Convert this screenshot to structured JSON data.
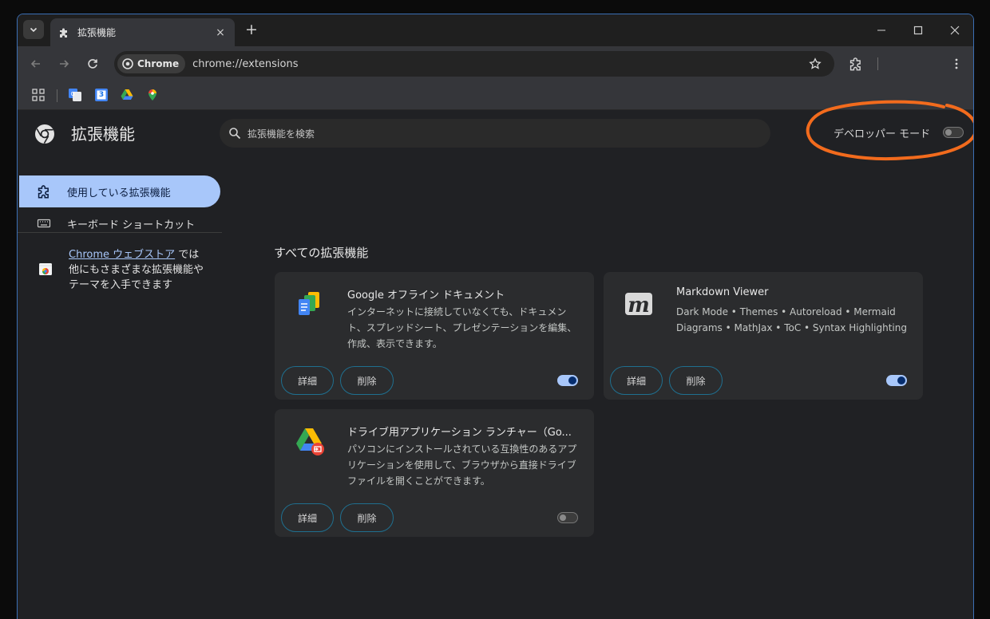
{
  "browser": {
    "tab": {
      "title": "拡張機能",
      "close_label": "×"
    },
    "new_tab_label": "+",
    "window_controls": {
      "minimize": "—",
      "maximize": "☐",
      "close": "✕"
    },
    "omnibox": {
      "chip_label": "Chrome",
      "url": "chrome://extensions"
    },
    "bookmarks": [
      "apps-grid-icon",
      "google-translate-icon",
      "google-calendar-icon",
      "google-drive-icon",
      "google-maps-icon"
    ],
    "calendar_day": "3"
  },
  "page": {
    "title": "拡張機能",
    "search_placeholder": "拡張機能を検索",
    "developer_mode": {
      "label": "デベロッパー モード",
      "enabled": false
    },
    "sidebar": {
      "items": [
        {
          "label": "使用している拡張機能",
          "active": true
        },
        {
          "label": "キーボード ショートカット",
          "active": false
        }
      ],
      "store": {
        "link": "Chrome ウェブストア",
        "text_after_link": " では",
        "text_rest": "他にもさまざまな拡張機能やテーマを入手できます"
      }
    },
    "section_title": "すべての拡張機能",
    "extensions": [
      {
        "name": "Google オフライン ドキュメント",
        "description": "インターネットに接続していなくても、ドキュメント、スプレッドシート、プレゼンテーションを編集、作成、表示できます。",
        "details_label": "詳細",
        "remove_label": "削除",
        "enabled": true
      },
      {
        "name": "Markdown Viewer",
        "description": "Dark Mode • Themes • Autoreload • Mermaid Diagrams • MathJax • ToC • Syntax Highlighting",
        "details_label": "詳細",
        "remove_label": "削除",
        "enabled": true
      },
      {
        "name": "ドライブ用アプリケーション ランチャー（Go...",
        "description": "パソコンにインストールされている互換性のあるアプリケーションを使用して、ブラウザから直接ドライブ ファイルを開くことができます。",
        "details_label": "詳細",
        "remove_label": "削除",
        "enabled": false
      }
    ]
  },
  "colors": {
    "accent": "#a8c7fa",
    "annotation": "#f26b1d",
    "window_border": "#3b6fb5"
  }
}
